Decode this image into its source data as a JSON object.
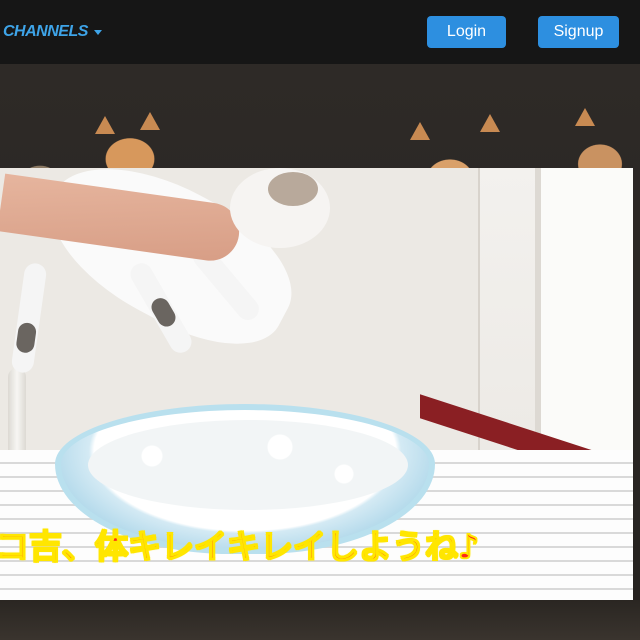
{
  "header": {
    "channels_label": "CHANNELS",
    "login_label": "Login",
    "signup_label": "Signup"
  },
  "video": {
    "subtitle": "コ吉、体キレイキレイしようね♪"
  },
  "colors": {
    "accent": "#3ea4e8",
    "button": "#2d8fe0",
    "subtitle_fill": "#ff2a1a",
    "subtitle_outline": "#ffe600"
  },
  "icons": {
    "channels_dropdown": "chevron-down-icon"
  }
}
